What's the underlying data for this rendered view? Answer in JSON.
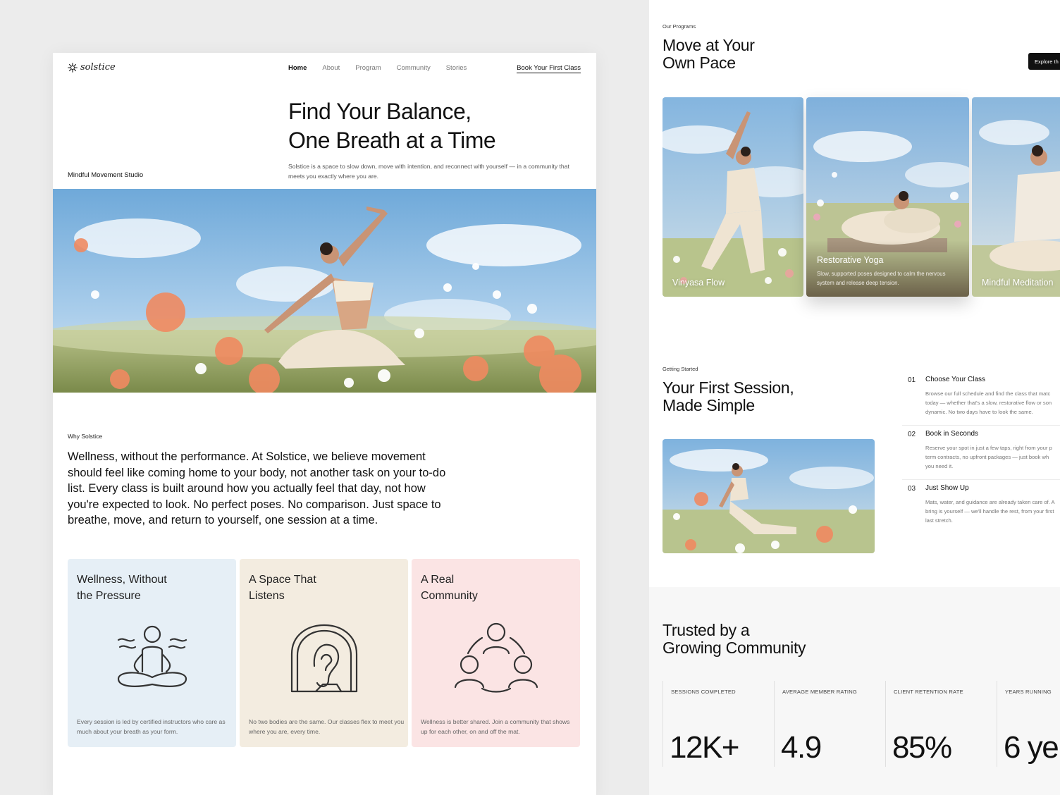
{
  "brand": {
    "name": "solstice"
  },
  "nav": {
    "links": [
      "Home",
      "About",
      "Program",
      "Community",
      "Stories"
    ],
    "active": "Home",
    "cta": "Book Your First Class"
  },
  "hero": {
    "title_line1": "Find Your Balance,",
    "title_line2": "One Breath at a Time",
    "subtitle": "Solstice is a space to slow down, move with intention, and reconnect with yourself — in a community that meets you exactly where you are.",
    "tag": "Mindful Movement Studio"
  },
  "why": {
    "label": "Why Solstice",
    "text": "Wellness, without the performance. At Solstice, we believe movement should feel like coming home to your body, not another task on your to-do list. Every class is built around how you actually feel that day, not how you're expected to look. No perfect poses. No comparison. Just space to breathe, move, and return to yourself, one session at a time."
  },
  "cards": [
    {
      "title_line1": "Wellness, Without",
      "title_line2": "the Pressure",
      "icon": "meditation-icon",
      "desc": "Every session is led by certified instructors who care as much about your breath as your form."
    },
    {
      "title_line1": "A Space That",
      "title_line2": "Listens",
      "icon": "ear-icon",
      "desc": "No two bodies are the same. Our classes flex to meet you where you are, every time."
    },
    {
      "title_line1": "A Real",
      "title_line2": "Community",
      "icon": "community-icon",
      "desc": "Wellness is better shared. Join a community that shows up for each other, on and off the mat."
    }
  ],
  "programs": {
    "eyebrow": "Our Programs",
    "title_line1": "Move at Your",
    "title_line2": "Own Pace",
    "explore": "Explore th",
    "items": [
      {
        "name": "Vinyasa Flow"
      },
      {
        "name": "Restorative Yoga",
        "desc": "Slow, supported poses designed to calm the nervous system and release deep tension."
      },
      {
        "name": "Mindful Meditation"
      }
    ]
  },
  "getting_started": {
    "eyebrow": "Getting Started",
    "title_line1": "Your First Session,",
    "title_line2": "Made Simple",
    "steps": [
      {
        "num": "01",
        "title": "Choose Your Class",
        "desc": "Browse our full schedule and find the class that matc\ntoday — whether that's a slow, restorative flow or son\ndynamic. No two days have to look the same."
      },
      {
        "num": "02",
        "title": "Book in Seconds",
        "desc": "Reserve your spot in just a few taps, right from your p\nterm contracts, no upfront packages — just book wh\nyou need it."
      },
      {
        "num": "03",
        "title": "Just Show Up",
        "desc": "Mats, water, and guidance are already taken care of. A\nbring is yourself — we'll handle the rest, from your first\nlast stretch."
      }
    ]
  },
  "trusted": {
    "title_line1": "Trusted by a",
    "title_line2": "Growing Community",
    "stats": [
      {
        "label": "SESSIONS COMPLETED",
        "value": "12K+"
      },
      {
        "label": "AVERAGE MEMBER RATING",
        "value": "4.9"
      },
      {
        "label": "CLIENT RETENTION RATE",
        "value": "85%"
      },
      {
        "label": "YEARS RUNNING",
        "value": "6 ye"
      }
    ]
  },
  "colors": {
    "card_blue": "#e6eff6",
    "card_beige": "#f3ece0",
    "card_pink": "#fbe4e4",
    "sky": "#8fbde0"
  }
}
